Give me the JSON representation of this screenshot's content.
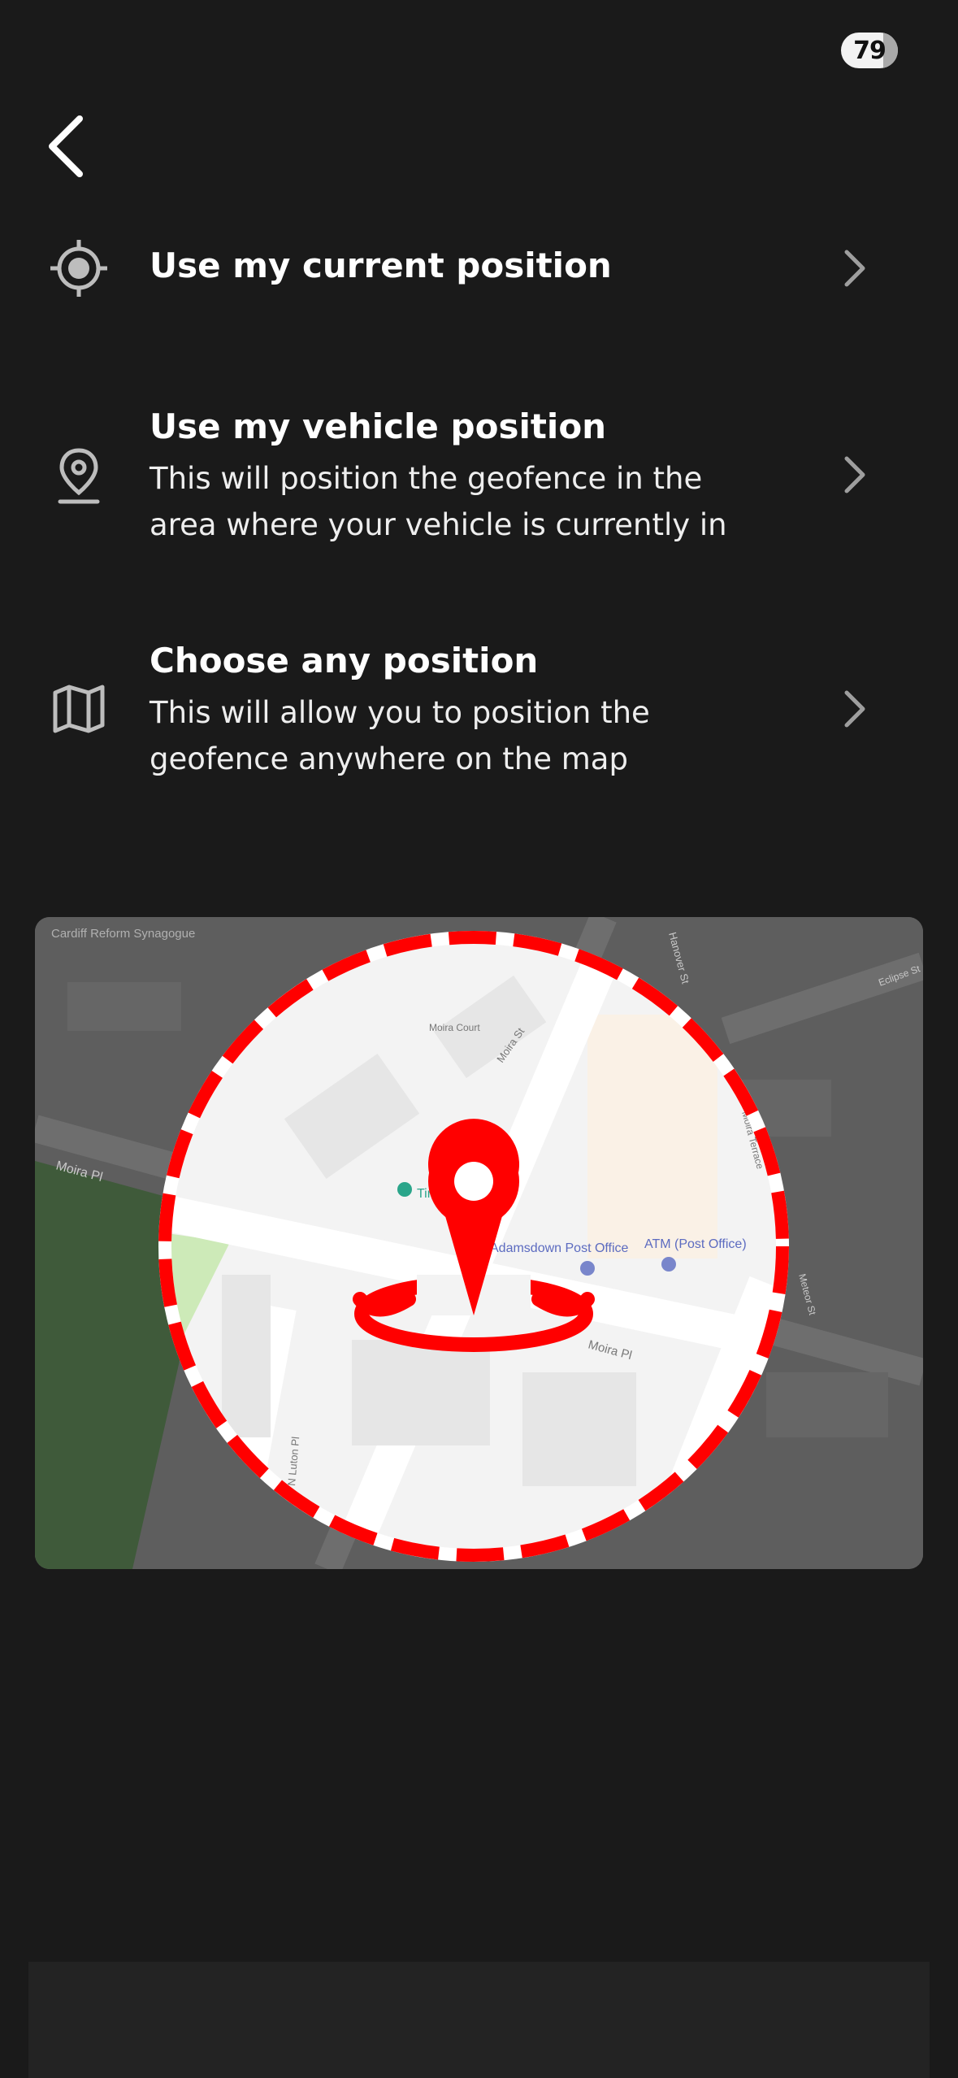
{
  "status": {
    "badge": "79"
  },
  "nav": {
    "back_icon": "chevron-left-icon"
  },
  "options": [
    {
      "icon": "crosshair-icon",
      "title": "Use my current position",
      "description": ""
    },
    {
      "icon": "location-pin-icon",
      "title": "Use my vehicle position",
      "description": "This will position the geofence in the area where your vehicle is currently in"
    },
    {
      "icon": "map-icon",
      "title": "Choose any position",
      "description": "This will allow you to position the geofence anywhere on the map"
    }
  ],
  "map": {
    "labels": {
      "synagogue": "Cardiff Reform Synagogue",
      "court": "Moira Court",
      "street_moira_st": "Moira St",
      "street_moira_pl_left": "Moira Pl",
      "street_moira_pl": "Moira Pl",
      "street_n_luton_pl": "N Luton Pl",
      "street_eclipse": "Eclipse St",
      "street_top": "Hanover St",
      "street_right": "Meteor St",
      "street_right2": "Moira Terrace",
      "poi_smurf": "Tiny Smurf Chi",
      "poi_post": "Adamsdown Post Office",
      "poi_atm": "ATM (Post Office)"
    },
    "overlay": {
      "circle_color": "#ff0000",
      "pin_color": "#ff0000"
    }
  }
}
